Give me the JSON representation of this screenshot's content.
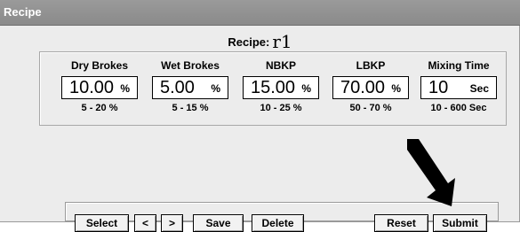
{
  "window": {
    "title": "Recipe"
  },
  "recipe": {
    "label": "Recipe:",
    "value": "r1"
  },
  "params": [
    {
      "label": "Dry Brokes",
      "value": "10.00",
      "unit": "%",
      "range": "5 - 20 %"
    },
    {
      "label": "Wet Brokes",
      "value": "5.00",
      "unit": "%",
      "range": "5 - 15 %"
    },
    {
      "label": "NBKP",
      "value": "15.00",
      "unit": "%",
      "range": "10 - 25 %"
    },
    {
      "label": "LBKP",
      "value": "70.00",
      "unit": "%",
      "range": "50 - 70 %"
    },
    {
      "label": "Mixing Time",
      "value": "10",
      "unit": "Sec",
      "range": "10 - 600 Sec"
    }
  ],
  "toolbar": {
    "select_label": "Select",
    "prev_label": "<",
    "next_label": ">",
    "save_label": "Save",
    "delete_label": "Delete",
    "reset_label": "Reset",
    "submit_label": "Submit"
  }
}
